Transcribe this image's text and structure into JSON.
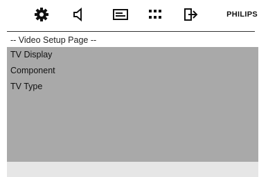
{
  "toolbar": {
    "icons": [
      "gear-icon",
      "speaker-icon",
      "subtitle-icon",
      "grid-icon",
      "exit-icon"
    ],
    "brand": "PHILIPS"
  },
  "page": {
    "title": "-- Video Setup Page --"
  },
  "menu": {
    "items": [
      {
        "label": "TV Display"
      },
      {
        "label": "Component"
      },
      {
        "label": "TV Type"
      }
    ]
  },
  "colors": {
    "menu_background": "#a9a9a9",
    "bottom_bar": "#e6e6e6",
    "text": "#111111"
  }
}
